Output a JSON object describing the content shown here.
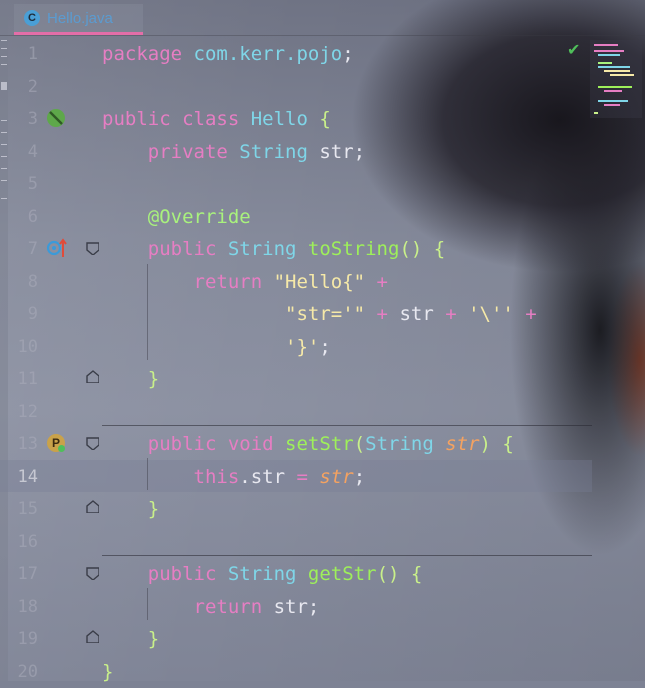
{
  "tab": {
    "icon_letter": "C",
    "filename": "Hello.java",
    "icon": "class-icon"
  },
  "status": {
    "icon": "check-icon",
    "glyph": "✔"
  },
  "editor": {
    "current_line": "14",
    "lines": [
      {
        "num": "1",
        "tokens": [
          [
            "kw",
            "package "
          ],
          [
            "pk",
            "com.kerr.pojo"
          ],
          [
            "tx",
            ";"
          ]
        ]
      },
      {
        "num": "2",
        "tokens": []
      },
      {
        "num": "3",
        "tokens": [
          [
            "kw",
            "public class "
          ],
          [
            "ty",
            "Hello "
          ],
          [
            "br",
            "{"
          ]
        ]
      },
      {
        "num": "4",
        "tokens": [
          [
            "tx",
            "    "
          ],
          [
            "kw",
            "private "
          ],
          [
            "ty",
            "String "
          ],
          [
            "tx",
            "str;"
          ]
        ]
      },
      {
        "num": "5",
        "tokens": []
      },
      {
        "num": "6",
        "tokens": [
          [
            "tx",
            "    "
          ],
          [
            "an",
            "@Override"
          ]
        ]
      },
      {
        "num": "7",
        "tokens": [
          [
            "tx",
            "    "
          ],
          [
            "kw",
            "public "
          ],
          [
            "ty",
            "String "
          ],
          [
            "fn",
            "toString"
          ],
          [
            "br",
            "() {"
          ]
        ]
      },
      {
        "num": "8",
        "tokens": [
          [
            "tx",
            "        "
          ],
          [
            "kw",
            "return "
          ],
          [
            "st",
            "\"Hello{\""
          ],
          [
            "op",
            " +"
          ]
        ]
      },
      {
        "num": "9",
        "tokens": [
          [
            "tx",
            "                "
          ],
          [
            "st",
            "\"str='\""
          ],
          [
            "op",
            " + "
          ],
          [
            "tx",
            "str"
          ],
          [
            "op",
            " + "
          ],
          [
            "st",
            "'\\''"
          ],
          [
            "op",
            " +"
          ]
        ]
      },
      {
        "num": "10",
        "tokens": [
          [
            "tx",
            "                "
          ],
          [
            "st",
            "'}'"
          ],
          [
            "tx",
            ";"
          ]
        ]
      },
      {
        "num": "11",
        "tokens": [
          [
            "tx",
            "    "
          ],
          [
            "br",
            "}"
          ]
        ]
      },
      {
        "num": "12",
        "tokens": []
      },
      {
        "num": "13",
        "tokens": [
          [
            "tx",
            "    "
          ],
          [
            "kw",
            "public void "
          ],
          [
            "fn",
            "setStr"
          ],
          [
            "br",
            "("
          ],
          [
            "ty",
            "String "
          ],
          [
            "pa",
            "str"
          ],
          [
            "br",
            ") {"
          ]
        ]
      },
      {
        "num": "14",
        "tokens": [
          [
            "tx",
            "        "
          ],
          [
            "kw",
            "this"
          ],
          [
            "tx",
            ".str "
          ],
          [
            "op",
            "= "
          ],
          [
            "pa",
            "str"
          ],
          [
            "tx",
            ";"
          ]
        ]
      },
      {
        "num": "15",
        "tokens": [
          [
            "tx",
            "    "
          ],
          [
            "br",
            "}"
          ]
        ]
      },
      {
        "num": "16",
        "tokens": []
      },
      {
        "num": "17",
        "tokens": [
          [
            "tx",
            "    "
          ],
          [
            "kw",
            "public "
          ],
          [
            "ty",
            "String "
          ],
          [
            "fn",
            "getStr"
          ],
          [
            "br",
            "() {"
          ]
        ]
      },
      {
        "num": "18",
        "tokens": [
          [
            "tx",
            "        "
          ],
          [
            "kw",
            "return "
          ],
          [
            "tx",
            "str;"
          ]
        ]
      },
      {
        "num": "19",
        "tokens": [
          [
            "tx",
            "    "
          ],
          [
            "br",
            "}"
          ]
        ]
      },
      {
        "num": "20",
        "tokens": [
          [
            "br",
            "}"
          ]
        ]
      }
    ]
  },
  "gutter": {
    "line3_icon": "no-entry-icon",
    "line7_icon": "override-up-icon",
    "line13_icon": "property-p-icon",
    "property_letter": "P"
  },
  "colors": {
    "keyword": "#e67ec3",
    "type": "#7fd6e8",
    "function": "#9ef05a",
    "string": "#f6e9a8",
    "parameter": "#f4a261",
    "tab_accent": "#e36ea8"
  }
}
